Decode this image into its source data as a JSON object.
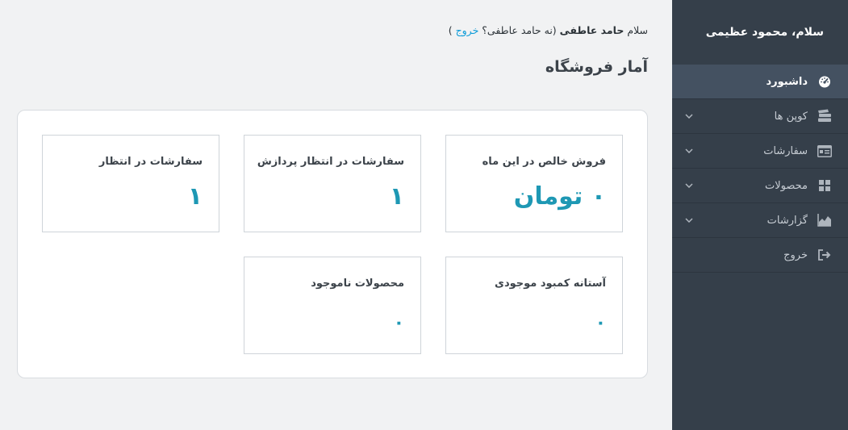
{
  "sidebar": {
    "greeting": "سلام، محمود عظیمی",
    "items": [
      {
        "label": "داشبورد",
        "icon": "dashboard-gauge-icon",
        "active": true
      },
      {
        "label": "کوپن ها",
        "icon": "coupons-tickets-icon",
        "active": false
      },
      {
        "label": "سفارشات",
        "icon": "orders-list-icon",
        "active": false
      },
      {
        "label": "محصولات",
        "icon": "products-grid-icon",
        "active": false
      },
      {
        "label": "گزارشات",
        "icon": "reports-chart-icon",
        "active": false
      },
      {
        "label": "خروج",
        "icon": "logout-icon",
        "active": false
      }
    ]
  },
  "header": {
    "greeting_prefix": "سلام",
    "user_name": "حامد عاطفی",
    "not_you_prefix": "(نه حامد عاطفی؟",
    "logout_link": "خروج",
    "not_you_suffix": ")"
  },
  "main": {
    "title": "آمار فروشگاه",
    "cards": [
      {
        "title": "فروش خالص در این ماه",
        "value": "۰ تومان"
      },
      {
        "title": "سفارشات در انتظار پردازش",
        "value": "۱"
      },
      {
        "title": "سفارشات در انتظار",
        "value": "۱"
      },
      {
        "title": "آستانه کمبود موجودی",
        "value": "۰"
      },
      {
        "title": "محصولات ناموجود",
        "value": "۰"
      }
    ]
  },
  "colors": {
    "sidebar_bg": "#353f4a",
    "sidebar_active": "#445161",
    "accent_value": "#1e98b4",
    "link": "#0b9bd8"
  }
}
